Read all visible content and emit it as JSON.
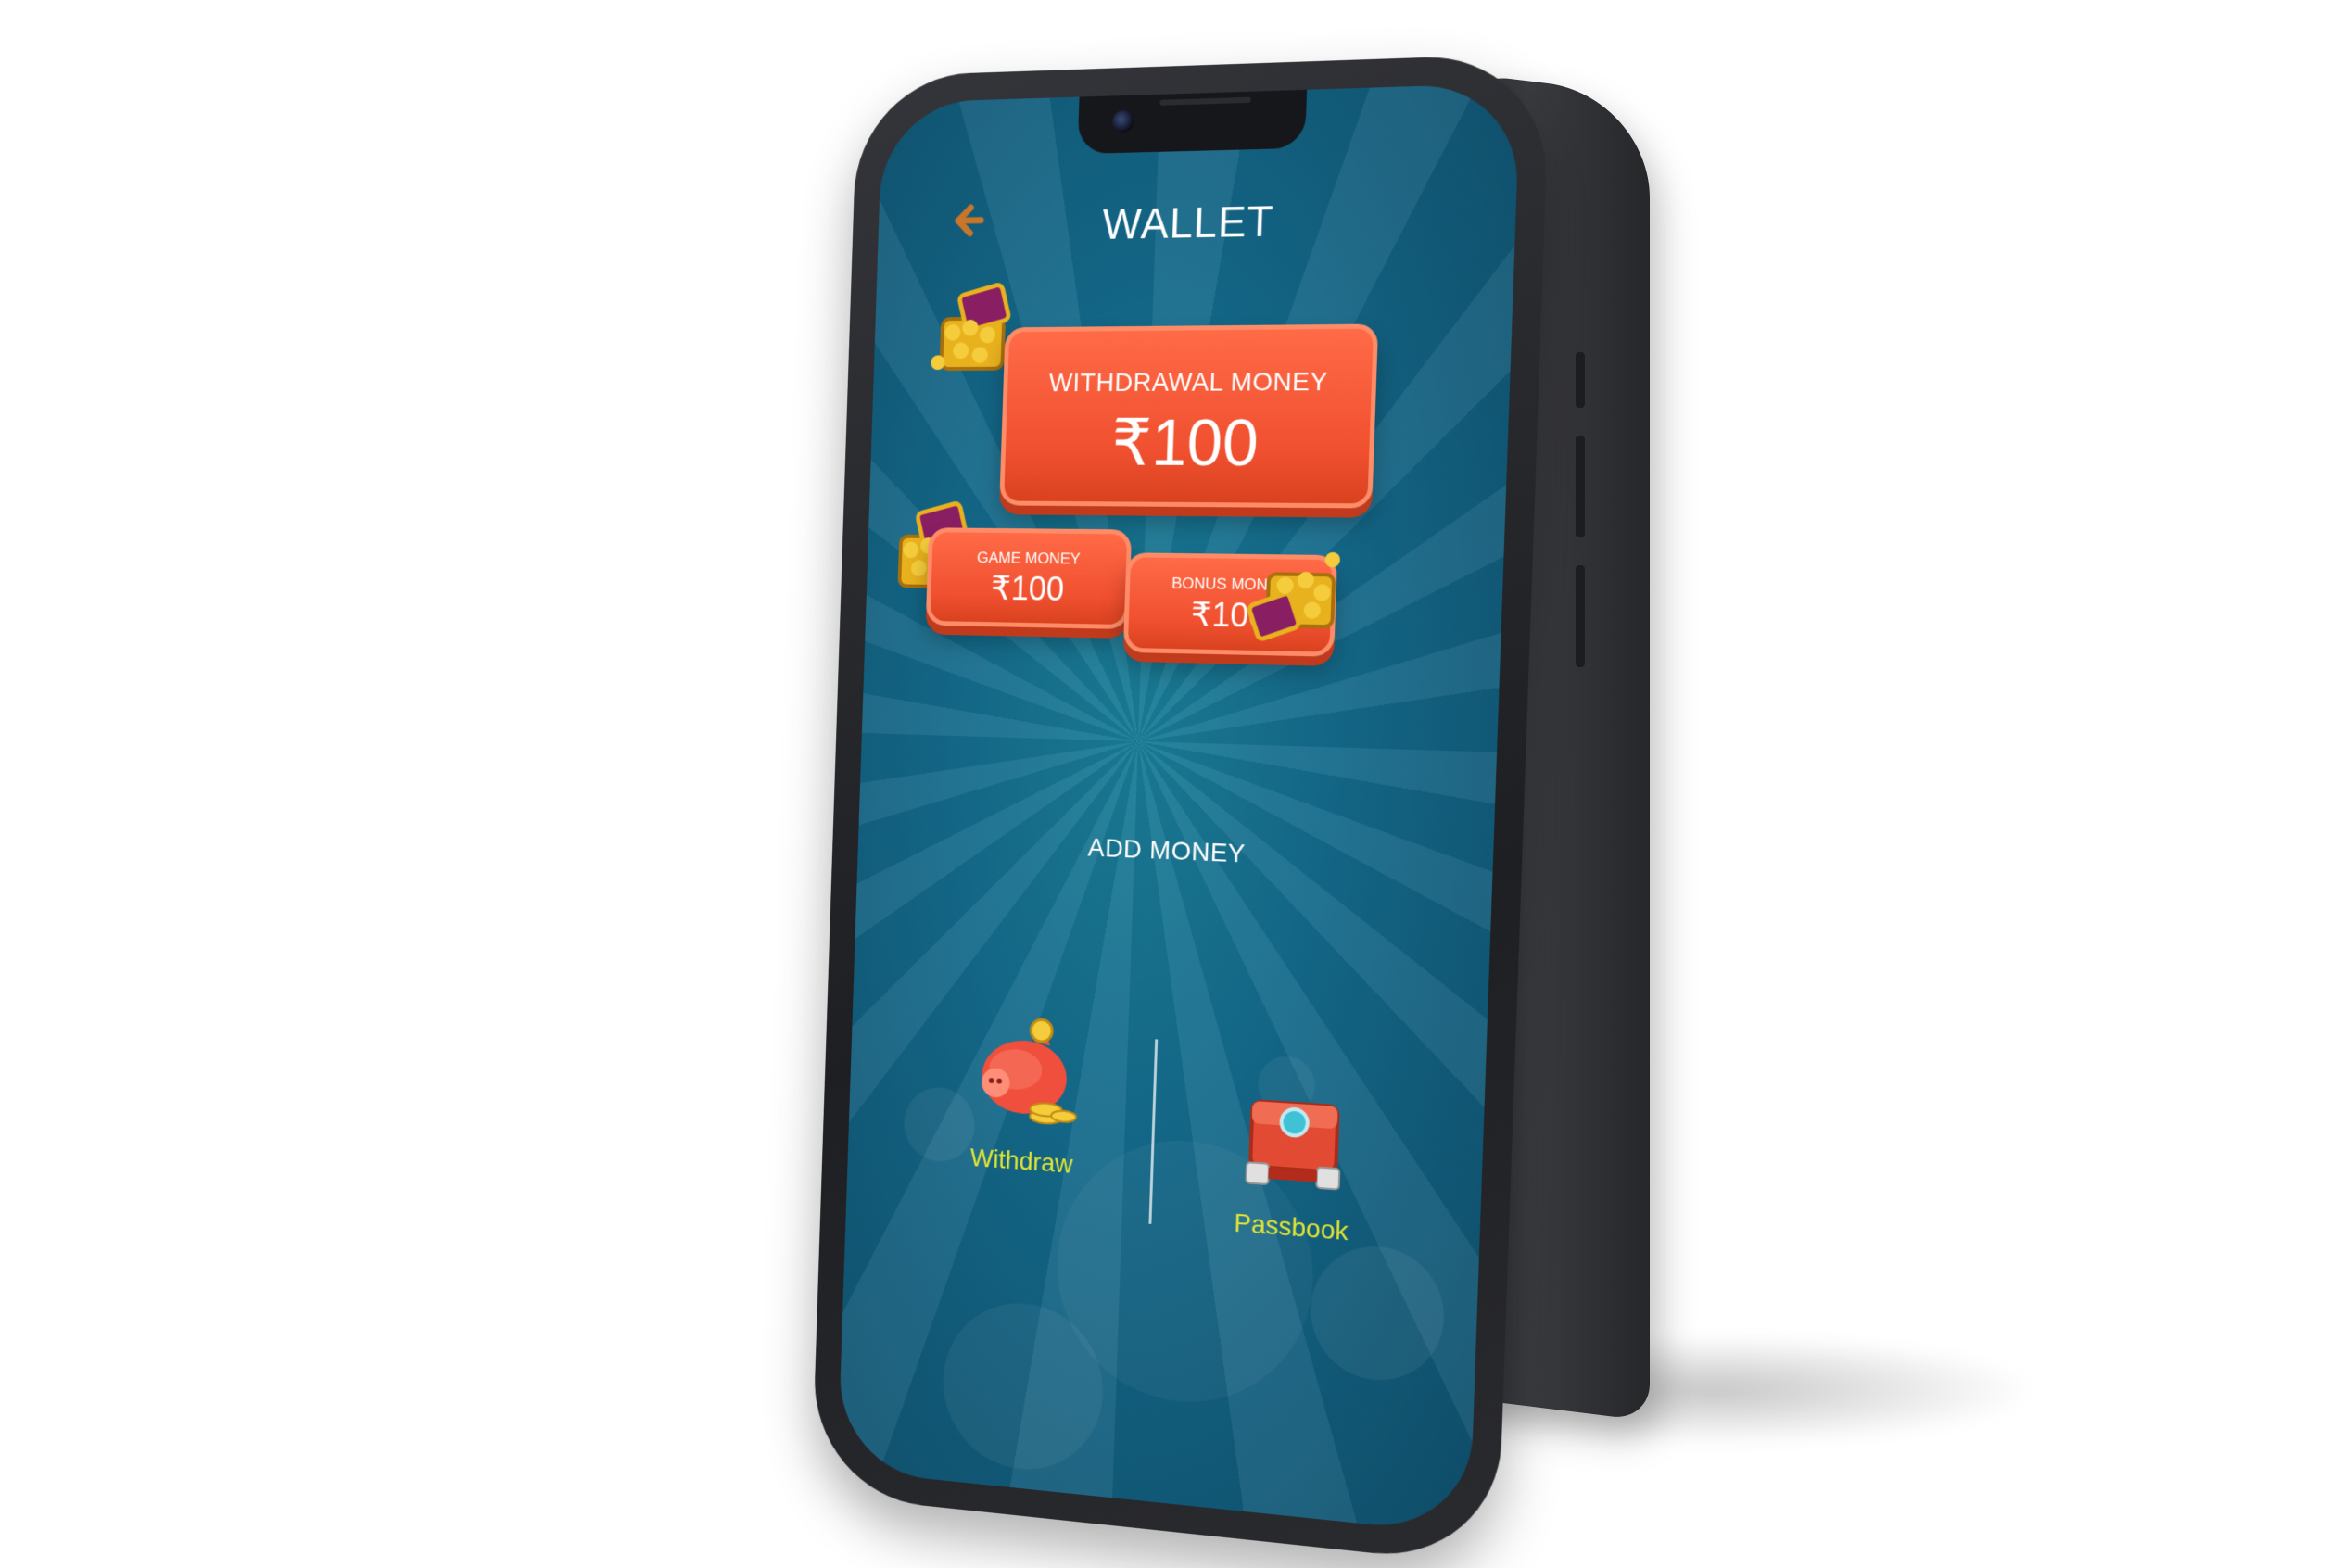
{
  "screen": {
    "title": "WALLET"
  },
  "header": {
    "back_icon": "arrow-left-icon"
  },
  "balances": {
    "withdrawal": {
      "label": "WITHDRAWAL MONEY",
      "amount": "₹100"
    },
    "game": {
      "label": "GAME MONEY",
      "amount": "₹100"
    },
    "bonus": {
      "label": "BONUS MONEY",
      "amount": "₹100"
    }
  },
  "actions": {
    "add_money": "ADD MONEY",
    "withdraw": {
      "label": "Withdraw",
      "icon": "piggy-bank-icon"
    },
    "passbook": {
      "label": "Passbook",
      "icon": "passbook-chest-icon"
    }
  },
  "colors": {
    "background_teal": "#14698a",
    "card_orange": "#f0502f",
    "caption_yellow": "#e2e534",
    "back_arrow": "#c9752a"
  }
}
